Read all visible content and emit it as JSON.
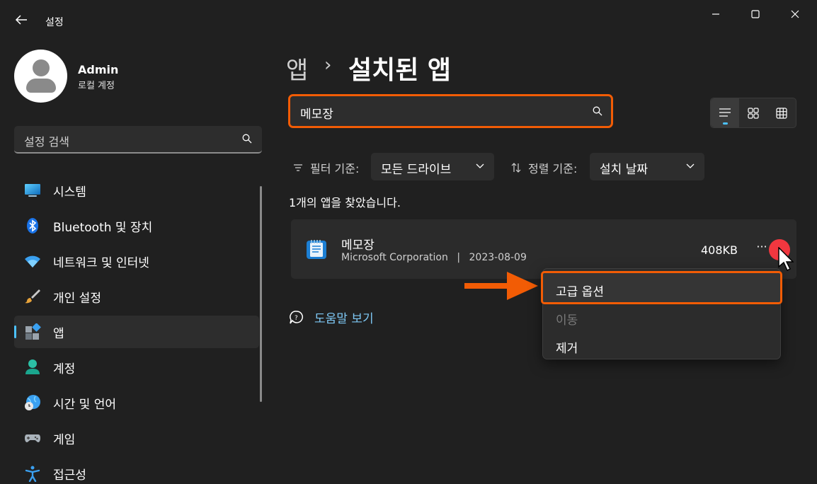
{
  "window": {
    "title": "설정",
    "back_icon": "back-arrow-icon"
  },
  "profile": {
    "name": "Admin",
    "account_type": "로컬 계정"
  },
  "sidebar": {
    "search_placeholder": "설정 검색",
    "items": [
      {
        "label": "시스템",
        "icon": "monitor-icon"
      },
      {
        "label": "Bluetooth 및 장치",
        "icon": "bluetooth-icon"
      },
      {
        "label": "네트워크 및 인터넷",
        "icon": "wifi-icon"
      },
      {
        "label": "개인 설정",
        "icon": "brush-icon"
      },
      {
        "label": "앱",
        "icon": "apps-icon",
        "active": true
      },
      {
        "label": "계정",
        "icon": "person-icon"
      },
      {
        "label": "시간 및 언어",
        "icon": "globe-clock-icon"
      },
      {
        "label": "게임",
        "icon": "gamepad-icon"
      },
      {
        "label": "접근성",
        "icon": "accessibility-icon"
      }
    ]
  },
  "breadcrumb": {
    "parent": "앱",
    "separator": "›",
    "current": "설치된 앱"
  },
  "search": {
    "value": "메모장"
  },
  "filter": {
    "label": "필터 기준:",
    "value": "모든 드라이브"
  },
  "sort": {
    "label": "정렬 기준:",
    "value": "설치 날짜"
  },
  "result_text": "1개의 앱을 찾았습니다.",
  "app": {
    "name": "메모장",
    "publisher": "Microsoft Corporation",
    "separator": "|",
    "date": "2023-08-09",
    "size": "408KB",
    "more_label": "···"
  },
  "context_menu": {
    "advanced": "고급 옵션",
    "move": "이동",
    "remove": "제거"
  },
  "help": {
    "label": "도움말 보기"
  },
  "colors": {
    "accent": "#4cc2ff",
    "highlight": "#f25c05",
    "click_marker": "#f1373f"
  }
}
